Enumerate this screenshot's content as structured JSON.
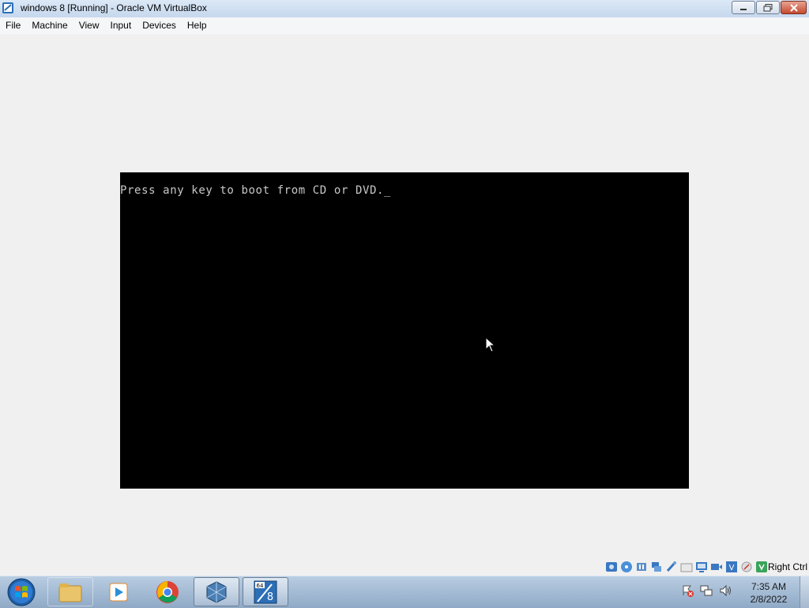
{
  "window": {
    "title": "windows 8 [Running] - Oracle VM VirtualBox",
    "icon": "virtualbox-icon",
    "controls": [
      "minimize-icon",
      "restore-icon",
      "close-icon"
    ]
  },
  "menu": {
    "items": [
      "File",
      "Machine",
      "View",
      "Input",
      "Devices",
      "Help"
    ]
  },
  "vm": {
    "console_text": "Press any key to boot from CD or DVD._"
  },
  "statusbar": {
    "icons": [
      "hard-disk-icon",
      "optical-drive-icon",
      "audio-icon",
      "network-icon",
      "usb-icon",
      "shared-folders-icon",
      "display-icon",
      "video-capture-icon",
      "virtualization-icon",
      "mouse-integration-icon",
      "keyboard-icon"
    ],
    "host_key": "Right Ctrl"
  },
  "taskbar": {
    "buttons": [
      "explorer-icon",
      "media-player-icon",
      "chrome-icon",
      "virtualbox-manager-icon",
      "windows8-vm-icon"
    ],
    "tray_icons": [
      "action-center-icon",
      "network-icon",
      "volume-icon"
    ],
    "clock": {
      "time": "7:35 AM",
      "date": "2/8/2022"
    }
  }
}
